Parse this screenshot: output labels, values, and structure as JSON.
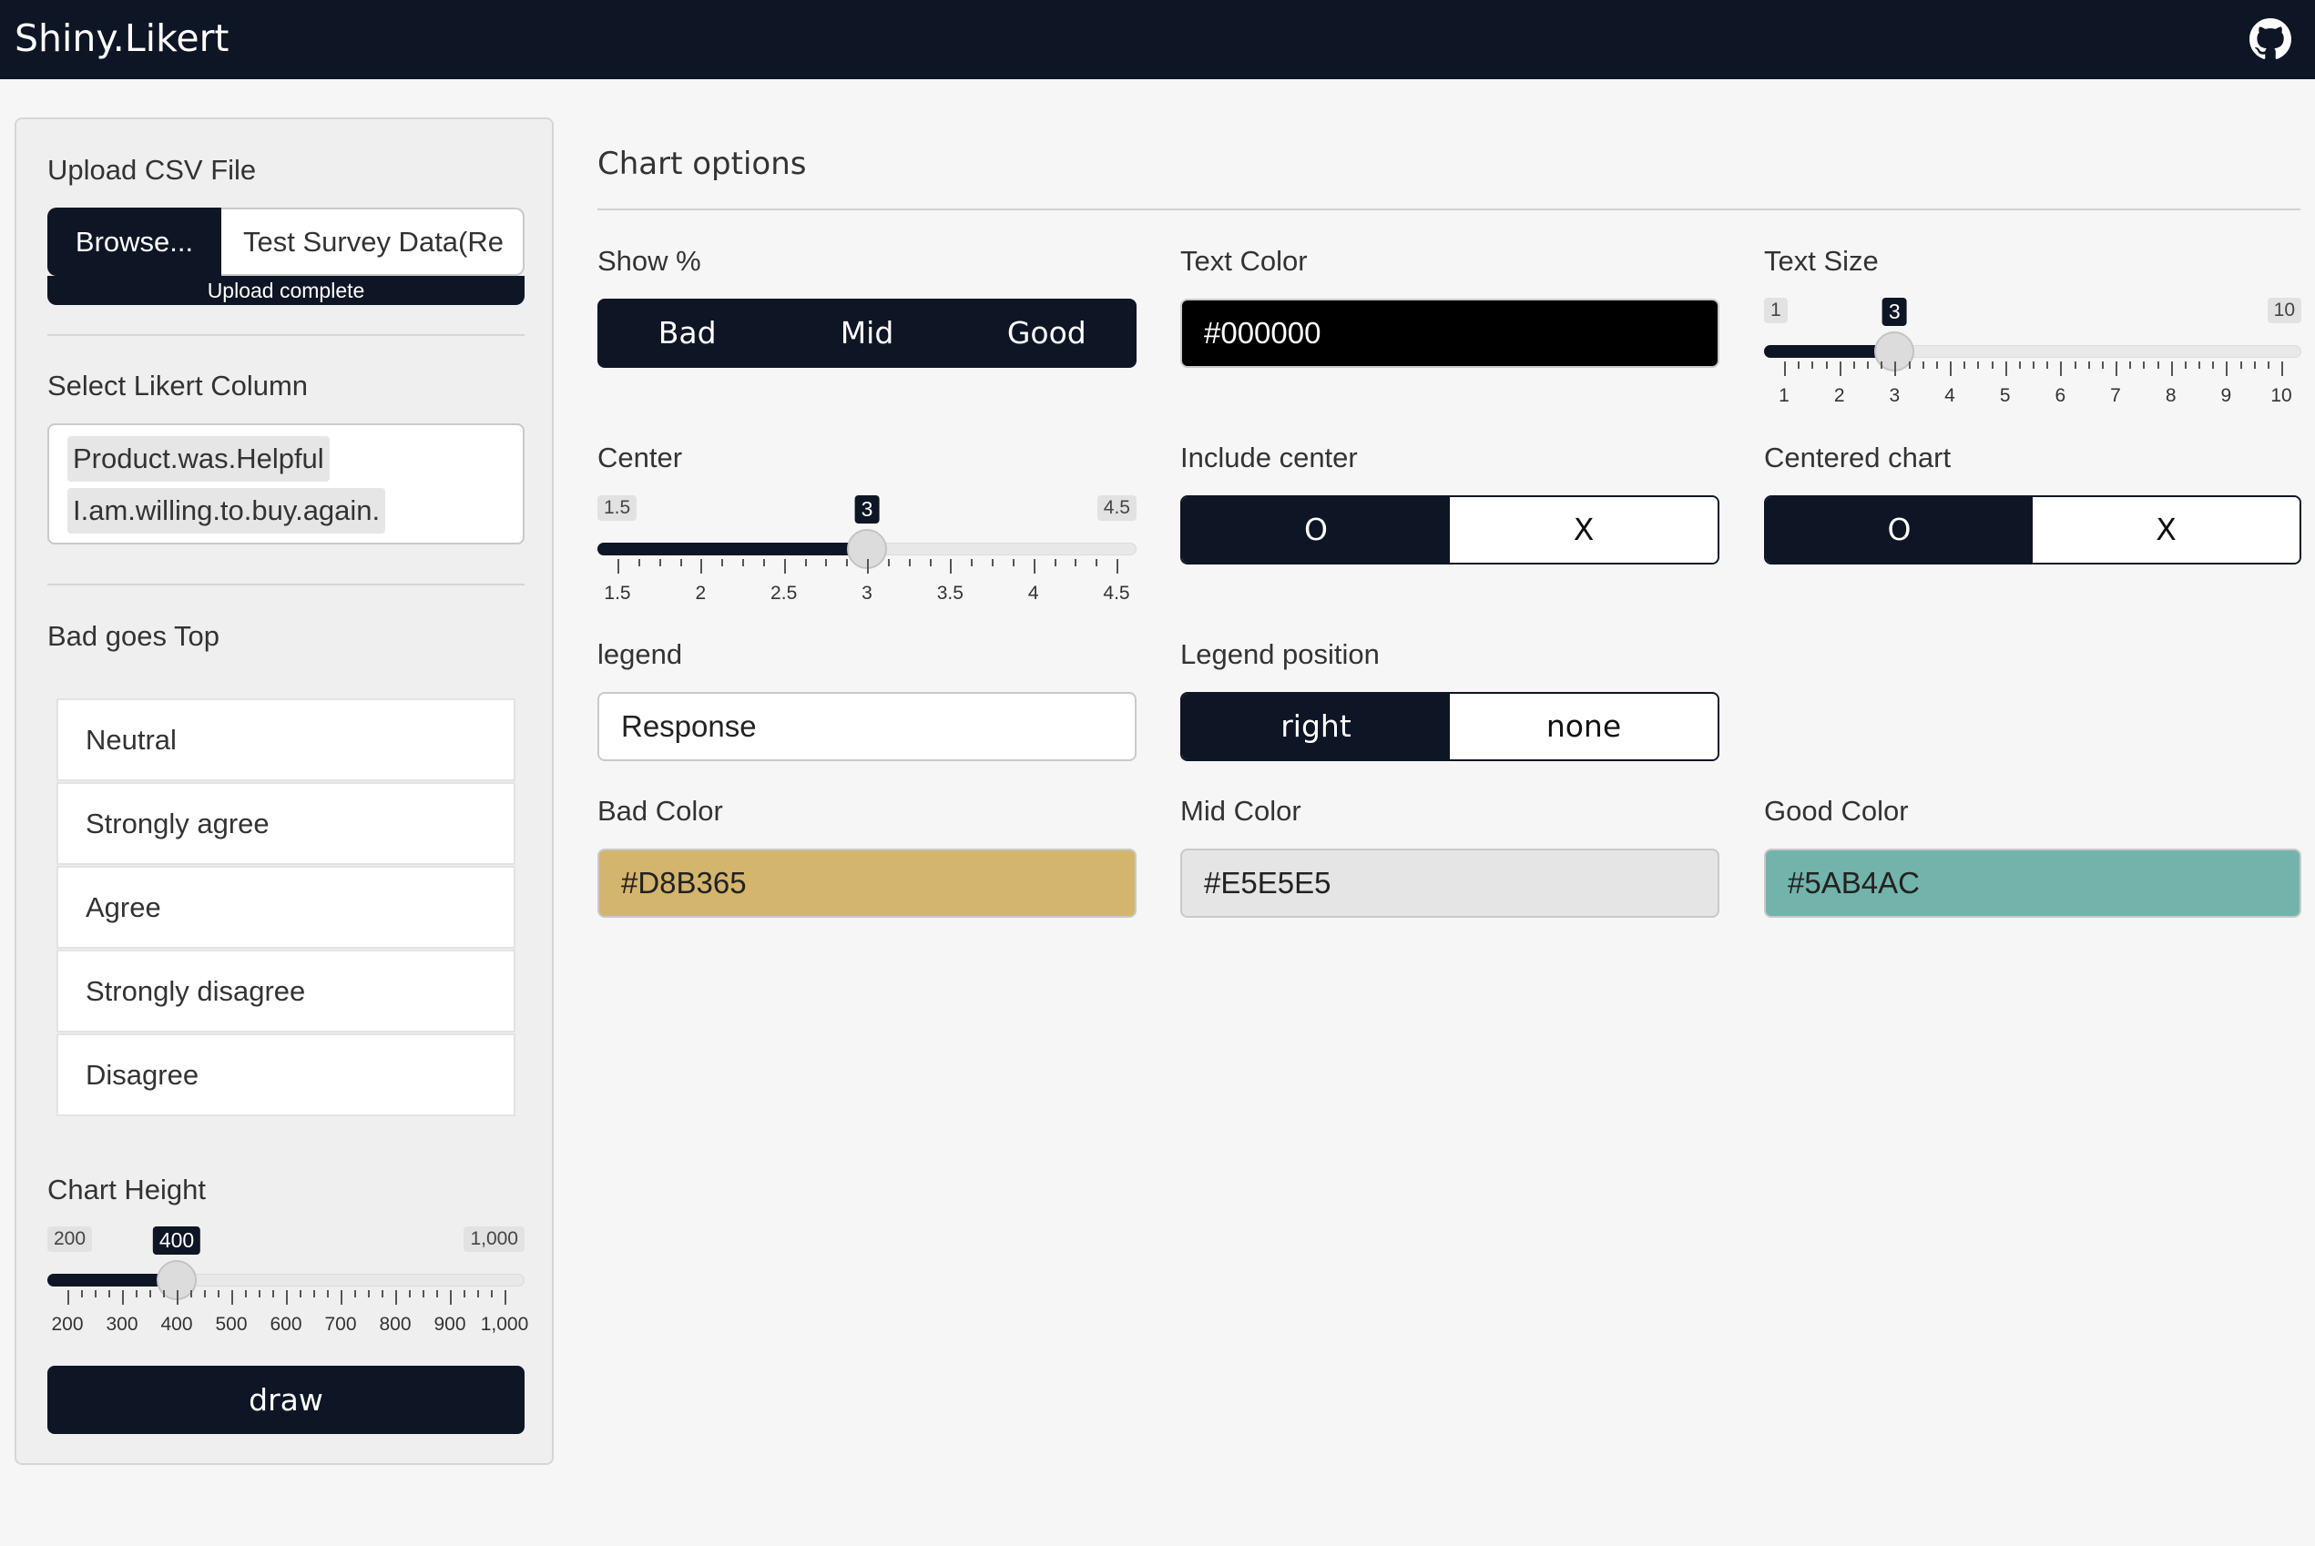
{
  "app": {
    "title": "Shiny.Likert",
    "github_icon": "github-icon"
  },
  "sidebar": {
    "upload": {
      "label": "Upload CSV File",
      "browse_label": "Browse...",
      "file_name": "Test Survey Data(Re",
      "progress_text": "Upload complete"
    },
    "likert_column": {
      "label": "Select Likert Column",
      "selected": [
        "Product.was.Helpful",
        "I.am.willing.to.buy.again."
      ]
    },
    "bad_goes_top": {
      "label": "Bad goes Top",
      "items": [
        "Neutral",
        "Strongly agree",
        "Agree",
        "Strongly disagree",
        "Disagree"
      ]
    },
    "chart_height": {
      "label": "Chart Height",
      "min": 200,
      "max": 1000,
      "value": 400,
      "min_label": "200",
      "max_label": "1,000",
      "value_label": "400",
      "ticks": [
        "200",
        "300",
        "400",
        "500",
        "600",
        "700",
        "800",
        "900",
        "1,000"
      ]
    },
    "draw_label": "draw"
  },
  "main": {
    "title": "Chart options",
    "show_pct": {
      "label": "Show %",
      "options": [
        "Bad",
        "Mid",
        "Good"
      ]
    },
    "text_color": {
      "label": "Text Color",
      "value": "#000000",
      "swatch": "#000000"
    },
    "text_size": {
      "label": "Text Size",
      "min": 1,
      "max": 10,
      "value": 3,
      "min_label": "1",
      "max_label": "10",
      "value_label": "3",
      "ticks": [
        "1",
        "2",
        "3",
        "4",
        "5",
        "6",
        "7",
        "8",
        "9",
        "10"
      ]
    },
    "center": {
      "label": "Center",
      "min": 1.5,
      "max": 4.5,
      "value": 3,
      "min_label": "1.5",
      "max_label": "4.5",
      "value_label": "3",
      "ticks": [
        "1.5",
        "2",
        "2.5",
        "3",
        "3.5",
        "4",
        "4.5"
      ]
    },
    "include_center": {
      "label": "Include center",
      "on": "O",
      "off": "X"
    },
    "centered_chart": {
      "label": "Centered chart",
      "on": "O",
      "off": "X"
    },
    "legend": {
      "label": "legend",
      "value": "Response"
    },
    "legend_position": {
      "label": "Legend position",
      "on": "right",
      "off": "none"
    },
    "bad_color": {
      "label": "Bad Color",
      "value": "#D8B365",
      "swatch": "#D4B56E"
    },
    "mid_color": {
      "label": "Mid Color",
      "value": "#E5E5E5",
      "swatch": "#E5E5E5"
    },
    "good_color": {
      "label": "Good Color",
      "value": "#5AB4AC",
      "swatch": "#72B4AB"
    }
  }
}
